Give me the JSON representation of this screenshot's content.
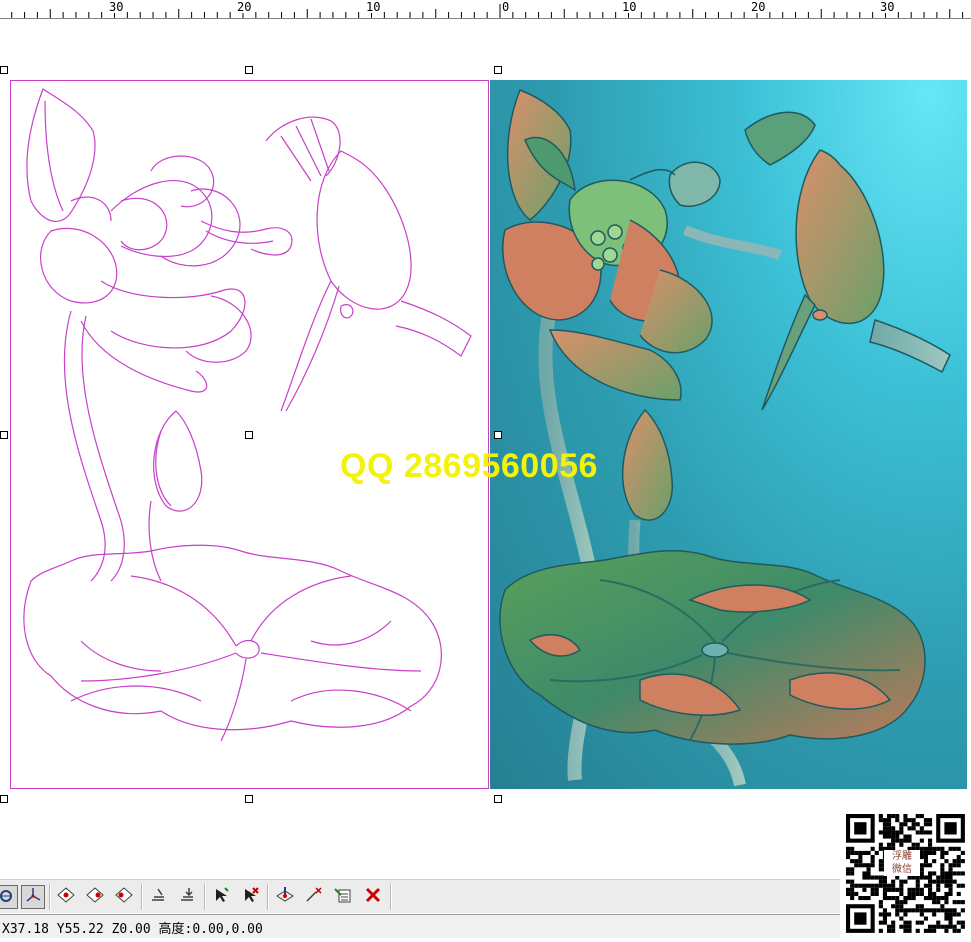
{
  "ruler": {
    "labels": [
      "30",
      "20",
      "10",
      "0",
      "10",
      "20",
      "30"
    ]
  },
  "watermark": {
    "text": "QQ 2869560056",
    "color": "#f2f20a"
  },
  "colors": {
    "vector_stroke": "#c840c8",
    "relief_background": "#2e9cb0",
    "relief_highlight": "#66e6f6"
  },
  "toolbar": {
    "icons": [
      "render-mode-icon",
      "axis-icon",
      "view-top-icon",
      "view-iso-icon",
      "view-side-icon",
      "layer-align-icon",
      "layer-down-icon",
      "select-arrow-icon",
      "deselect-arrow-icon",
      "node-edit-icon",
      "node-delete-icon",
      "list-edit-icon",
      "delete-x-icon"
    ]
  },
  "status": {
    "coordinates": "X37.18 Y55.22 Z0.00 高度:0.00,0.00"
  },
  "qr": {
    "caption_line1": "浮雕",
    "caption_line2": "微信"
  }
}
